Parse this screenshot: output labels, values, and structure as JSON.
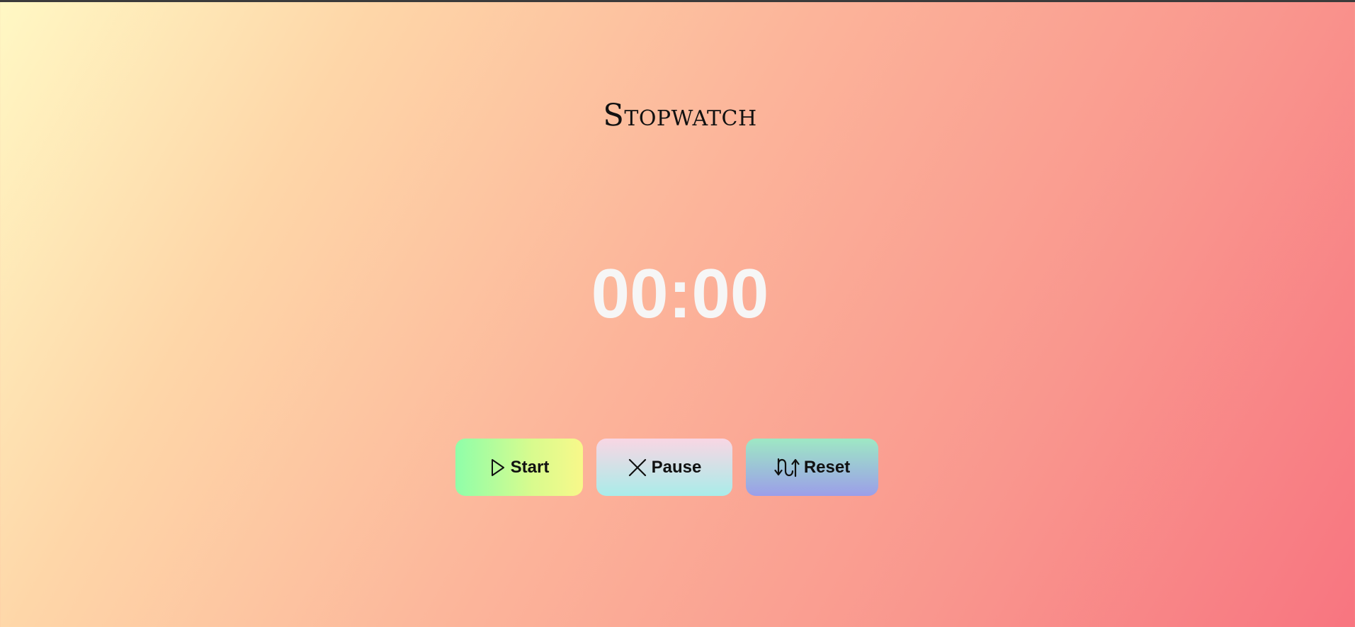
{
  "app": {
    "title": "Stopwatch"
  },
  "timer": {
    "display": "00:00"
  },
  "controls": {
    "start_label": "Start",
    "start_icon": "play-icon",
    "pause_label": "Pause",
    "pause_icon": "close-icon",
    "reset_label": "Reset",
    "reset_icon": "swap-arrows-icon"
  },
  "colors": {
    "background_start": "#fff8c4",
    "background_end": "#f87580",
    "timer_text": "#f6f6f6"
  }
}
